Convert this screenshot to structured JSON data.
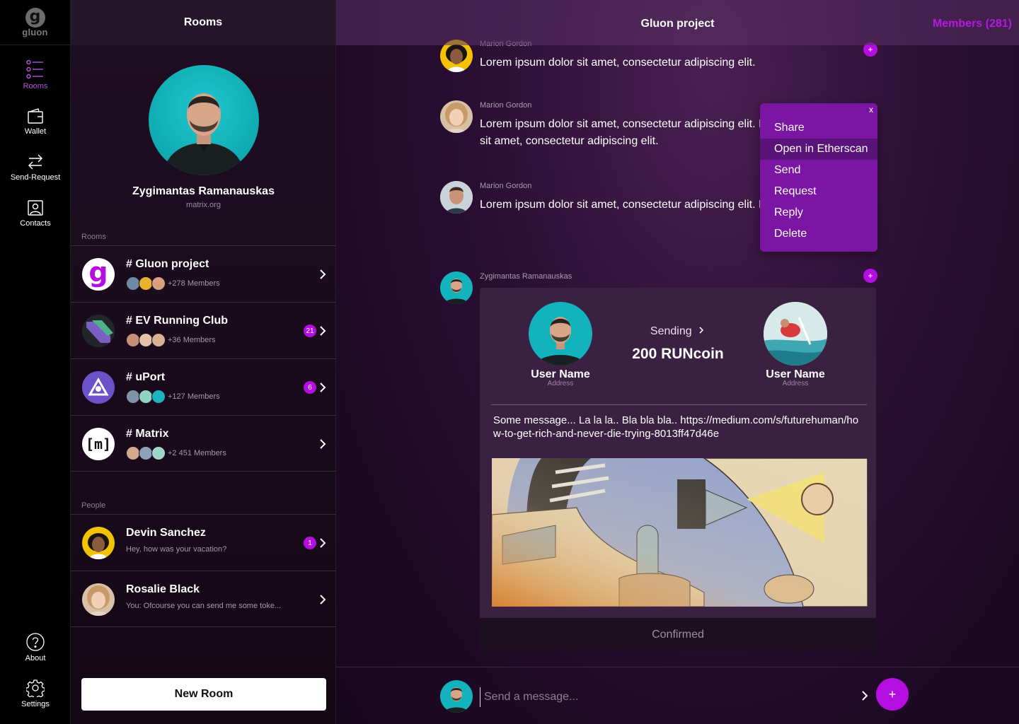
{
  "app": {
    "logo_text": "gluon",
    "logo_glyph": "g"
  },
  "nav": {
    "items": [
      {
        "label": "Rooms",
        "icon": "rooms-list-icon",
        "active": true
      },
      {
        "label": "Wallet",
        "icon": "wallet-icon",
        "active": false
      },
      {
        "label": "Send-Request",
        "icon": "swap-arrows-icon",
        "active": false
      },
      {
        "label": "Contacts",
        "icon": "contacts-icon",
        "active": false
      }
    ],
    "bottom": [
      {
        "label": "About",
        "icon": "help-icon"
      },
      {
        "label": "Settings",
        "icon": "gear-icon"
      }
    ]
  },
  "rooms_panel": {
    "title": "Rooms",
    "profile": {
      "name": "Zygimantas Ramanauskas",
      "server": "matrix.org"
    },
    "rooms_section_label": "Rooms",
    "rooms": [
      {
        "name": "# Gluon project",
        "members": "+278 Members",
        "badge": ""
      },
      {
        "name": "# EV Running Club",
        "members": "+36 Members",
        "badge": "21"
      },
      {
        "name": "# uPort",
        "members": "+127 Members",
        "badge": "6"
      },
      {
        "name": "# Matrix",
        "members": "+2 451 Members",
        "badge": ""
      }
    ],
    "people_section_label": "People",
    "people": [
      {
        "name": "Devin Sanchez",
        "last_message": "Hey, how was your vacation?",
        "badge": "1"
      },
      {
        "name": "Rosalie Black",
        "last_message": "You: Ofcourse you can send me some toke...",
        "badge": ""
      }
    ],
    "new_room_label": "New Room"
  },
  "chat": {
    "title": "Gluon project",
    "members_label": "Members (281)",
    "messages": [
      {
        "author": "Marion Gordon",
        "text": "Lorem ipsum dolor sit amet, consectetur adipiscing elit."
      },
      {
        "author": "Marion Gordon",
        "text_line1": "Lorem ipsum dolor sit amet, consectetur adipiscing elit. Lore",
        "text_line2": "sit amet, consectetur adipiscing elit."
      },
      {
        "author": "Marion Gordon",
        "text": "Lorem ipsum dolor sit amet, consectetur adipiscing elit. Lore"
      }
    ],
    "plus_label": "+",
    "context_menu": {
      "close_label": "x",
      "items": [
        "Share",
        "Open in Etherscan",
        "Send",
        "Request",
        "Reply",
        "Delete"
      ],
      "hovered": "Open in Etherscan"
    },
    "transaction": {
      "author": "Zygimantas Ramanauskas",
      "sender_name": "User Name",
      "sender_address": "Address",
      "recipient_name": "User Name",
      "recipient_address": "Address",
      "status_label": "Sending",
      "amount": "200 RUNcoin",
      "message": "Some message... La la la.. Bla bla bla.. https://medium.com/s/futurehuman/how-to-get-rich-and-never-die-trying-8013ff47d46e",
      "footer": "Confirmed"
    },
    "composer": {
      "placeholder": "Send a message...",
      "add_label": "+"
    }
  },
  "colors": {
    "accent": "#b40fe0",
    "members": "#b31be0",
    "menu": "#7a15a4"
  }
}
